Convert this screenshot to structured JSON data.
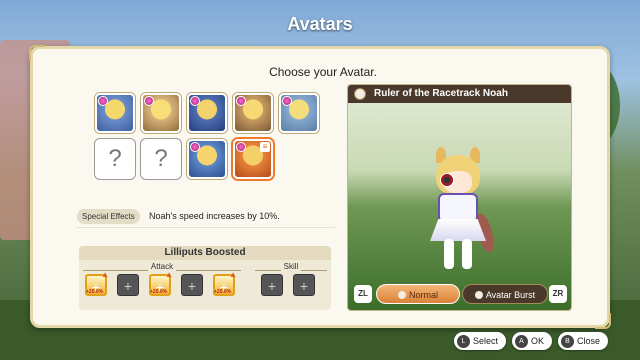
{
  "title": "Avatars",
  "prompt": "Choose your Avatar.",
  "avatars": [
    {
      "label": "",
      "state": "owned"
    },
    {
      "label": "",
      "state": "owned"
    },
    {
      "label": "",
      "state": "owned"
    },
    {
      "label": "",
      "state": "owned"
    },
    {
      "label": "",
      "state": "owned"
    },
    {
      "label": "?",
      "state": "unknown"
    },
    {
      "label": "?",
      "state": "unknown"
    },
    {
      "label": "",
      "state": "owned"
    },
    {
      "label": "",
      "state": "selected"
    }
  ],
  "special_effects": {
    "label": "Special Effects",
    "text": "Noah's speed increases by 10%."
  },
  "lilliputs": {
    "title": "Lilliputs Boosted",
    "attack_label": "Attack",
    "skill_label": "Skill",
    "plus": "+",
    "boost_text": "+20.0%"
  },
  "preview": {
    "name": "Ruler of the Racetrack Noah",
    "zl": "ZL",
    "zr": "ZR",
    "normal": "Normal",
    "burst": "Avatar Burst"
  },
  "footer": {
    "select_key": "L",
    "select": "Select",
    "ok_key": "A",
    "ok": "OK",
    "close_key": "B",
    "close": "Close"
  },
  "colors": {
    "accent": "#f07a2a",
    "panel": "#faf8ef",
    "namebar": "#4a382a"
  }
}
